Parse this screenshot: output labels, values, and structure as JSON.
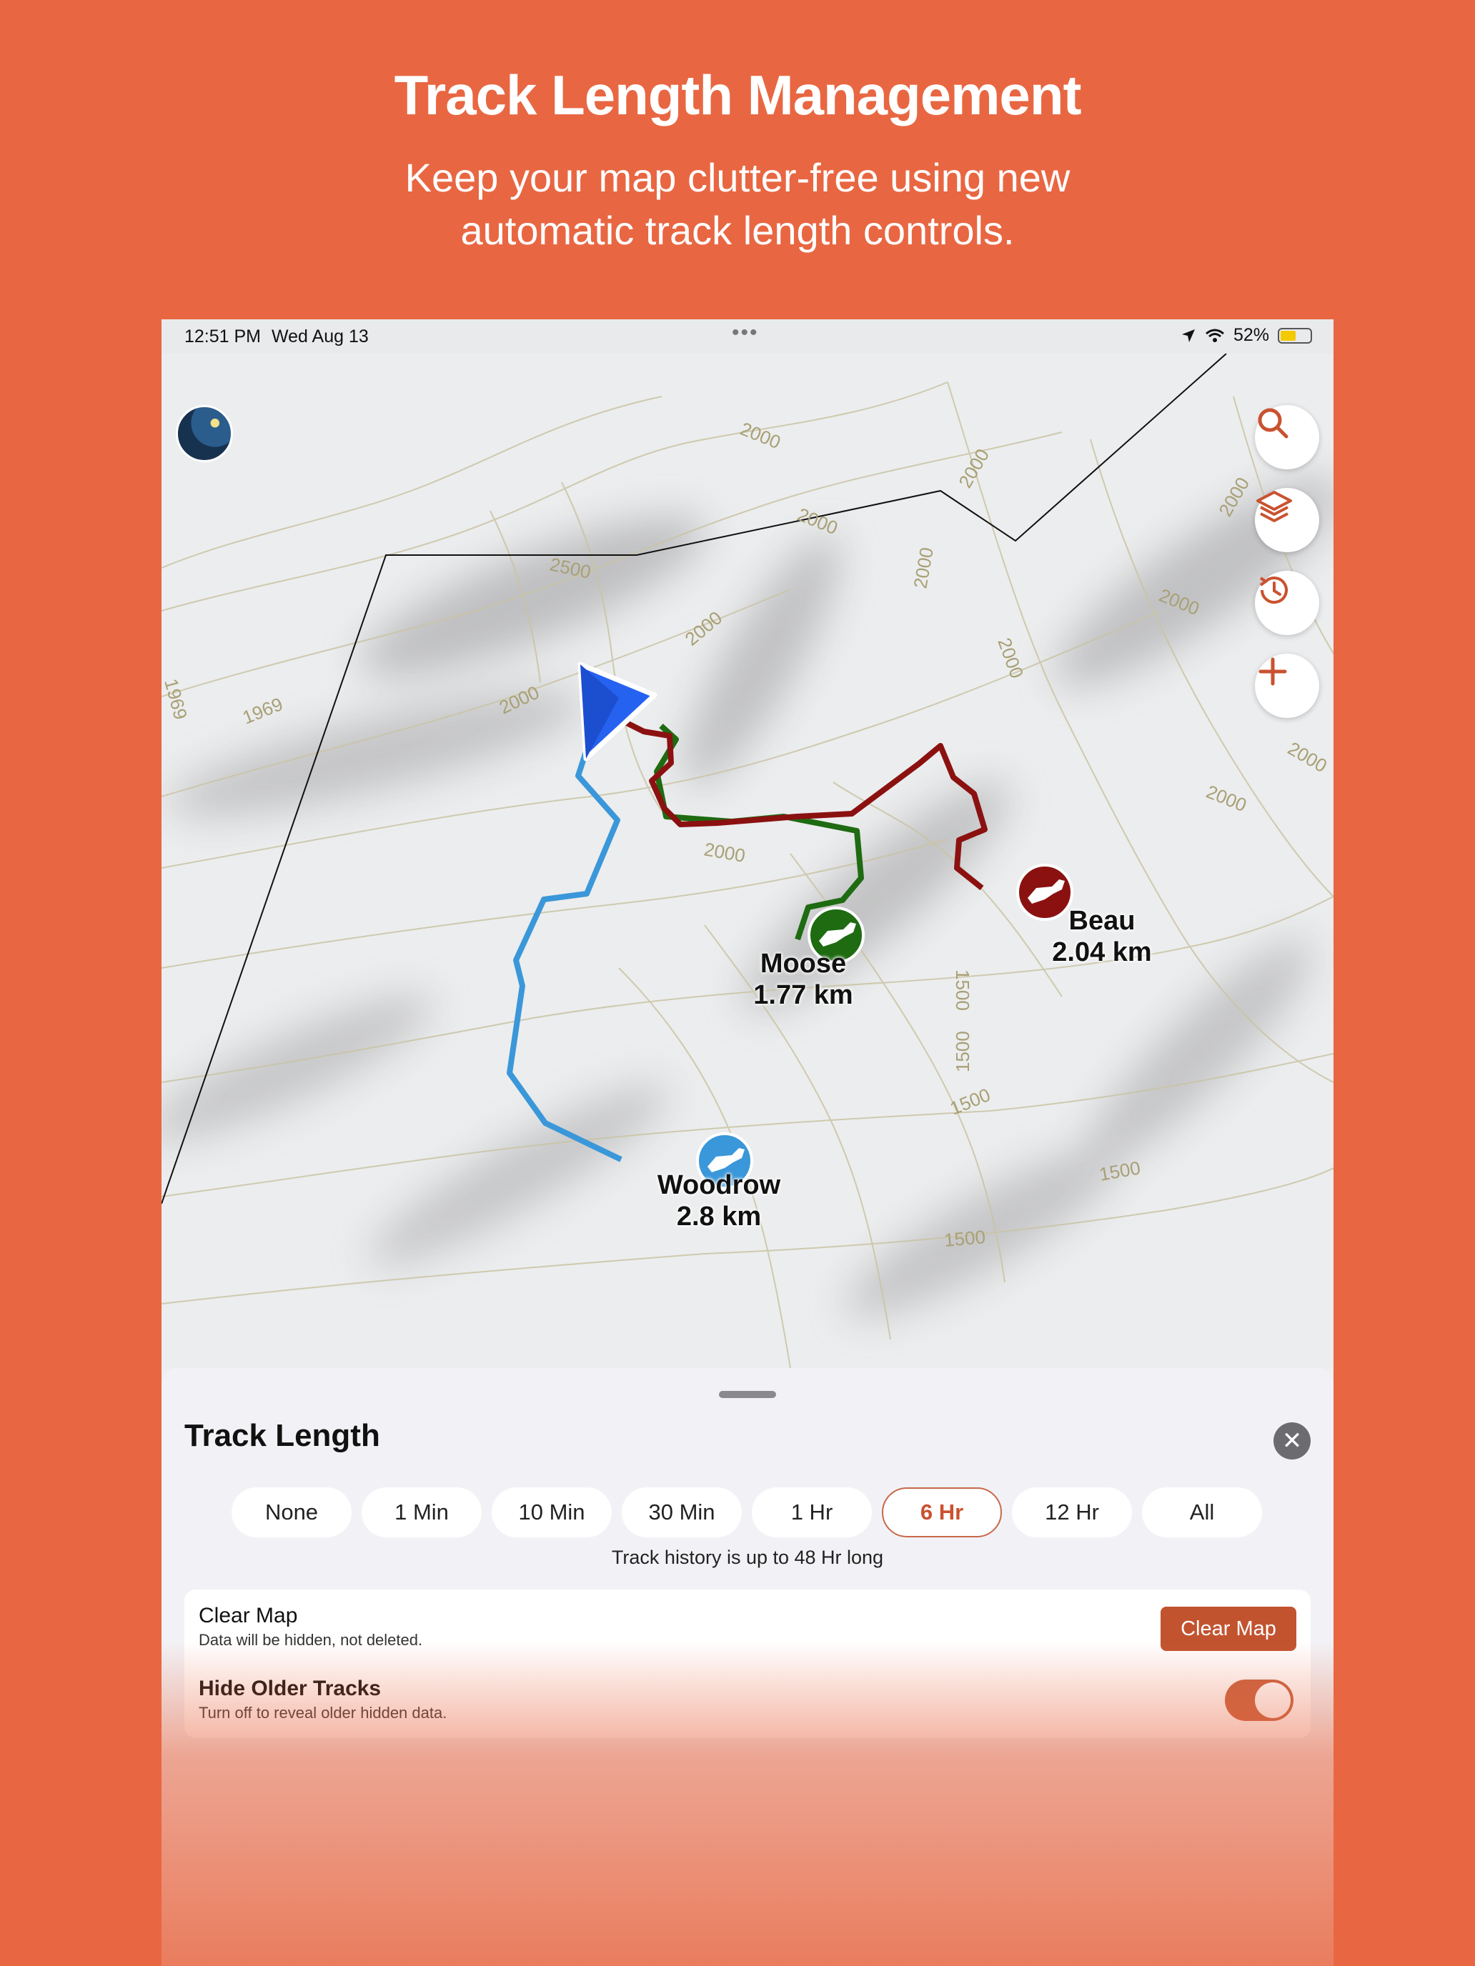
{
  "promo": {
    "title": "Track Length Management",
    "subtitle_line1": "Keep your map clutter-free using new",
    "subtitle_line2": "automatic track length controls."
  },
  "status_bar": {
    "time": "12:51 PM",
    "date": "Wed Aug 13",
    "battery": "52%",
    "battery_level": 0.52
  },
  "map": {
    "contour_labels": [
      "2000",
      "2000",
      "2000",
      "2000",
      "2000",
      "2000",
      "2000",
      "2000",
      "2000",
      "2000",
      "2000",
      "2000",
      "2500",
      "1969",
      "1969",
      "1500",
      "1500",
      "1500",
      "1500",
      "1500"
    ],
    "dogs": [
      {
        "name": "Woodrow",
        "distance": "2.8 km",
        "color": "#3A97D9"
      },
      {
        "name": "Moose",
        "distance": "1.77 km",
        "color": "#1E6B12"
      },
      {
        "name": "Beau",
        "distance": "2.04 km",
        "color": "#8B1111"
      }
    ],
    "map_buttons": [
      "search-icon",
      "layers-icon",
      "history-icon",
      "plus-icon"
    ],
    "accent_color": "#C9522F"
  },
  "sheet": {
    "title": "Track Length",
    "options": [
      "None",
      "1 Min",
      "10 Min",
      "30 Min",
      "1 Hr",
      "6 Hr",
      "12 Hr",
      "All"
    ],
    "selected_option": "6 Hr",
    "history_note": "Track history is up to 48 Hr long",
    "clear_map": {
      "title": "Clear Map",
      "subtitle": "Data will be hidden, not deleted.",
      "button_label": "Clear Map"
    },
    "hide_older": {
      "title": "Hide Older Tracks",
      "subtitle": "Turn off to reveal older hidden data.",
      "enabled": true
    }
  }
}
